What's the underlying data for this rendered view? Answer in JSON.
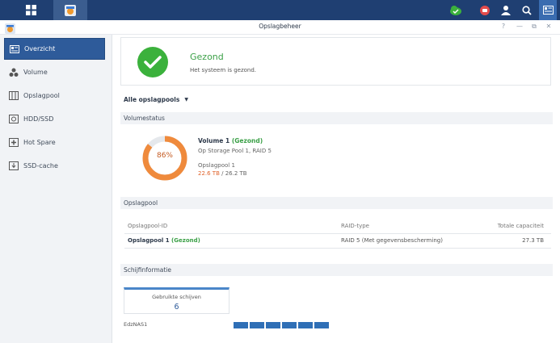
{
  "window": {
    "title": "Opslagbeheer"
  },
  "taskbar": {
    "icons": [
      "main-menu-icon",
      "storage-manager-icon",
      "cloud-sync-icon",
      "notification-icon",
      "user-icon",
      "search-icon",
      "widgets-icon"
    ]
  },
  "window_controls": {
    "help": "?",
    "minimize": "—",
    "restore": "⧉",
    "close": "✕"
  },
  "sidebar": {
    "items": [
      {
        "label": "Overzicht",
        "icon": "overview-icon",
        "active": true
      },
      {
        "label": "Volume",
        "icon": "volume-icon"
      },
      {
        "label": "Opslagpool",
        "icon": "storage-pool-icon"
      },
      {
        "label": "HDD/SSD",
        "icon": "hdd-icon"
      },
      {
        "label": "Hot Spare",
        "icon": "hot-spare-icon"
      },
      {
        "label": "SSD-cache",
        "icon": "ssd-cache-icon"
      }
    ]
  },
  "health": {
    "title": "Gezond",
    "subtitle": "Het systeem is gezond.",
    "color": "#3bb13c"
  },
  "pool_selector": {
    "label": "Alle opslagpools"
  },
  "volume_status": {
    "heading": "Volumestatus",
    "percent_label": "86%",
    "percent": 86,
    "volume_name": "Volume 1",
    "volume_state": "(Gezond)",
    "location": "Op Storage Pool 1, RAID 5",
    "pool_name": "Opslagpool 1",
    "used": "22.6 TB",
    "separator": "/",
    "total": "26.2 TB"
  },
  "storage_pool": {
    "heading": "Opslagpool",
    "columns": [
      "Opslagpool-ID",
      "RAID-type",
      "Totale capaciteit"
    ],
    "rows": [
      {
        "id": "Opslagpool 1",
        "state": "(Gezond)",
        "raid": "RAID 5 (Met gegevensbescherming)",
        "capacity": "27.3 TB"
      }
    ]
  },
  "disk_info": {
    "heading": "Schijfinformatie",
    "used_disks_label": "Gebruikte schijven",
    "used_disks_count": "6",
    "host": "EdzNAS1",
    "slots": 6
  },
  "colors": {
    "accent": "#2e5b9a",
    "healthy": "#3ba047",
    "warning": "#e0632b",
    "disk": "#2f6fb6"
  }
}
